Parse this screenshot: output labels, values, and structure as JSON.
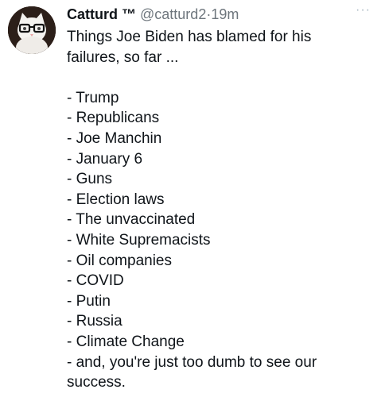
{
  "tweet": {
    "display_name": "Catturd ™",
    "handle": "@catturd2",
    "separator": "·",
    "time": "19m",
    "more_label": "···",
    "intro_line1": "Things Joe Biden has blamed for his",
    "intro_line2": "failures, so far ...",
    "items": [
      "- Trump",
      "- Republicans",
      "- Joe Manchin",
      "- January 6",
      "- Guns",
      "- Election laws",
      "- The unvaccinated",
      "- White Supremacists",
      "- Oil companies",
      "- COVID",
      "- Putin",
      "- Russia",
      "- Climate Change"
    ],
    "closing_line1": "- and, you're just too dumb to see our",
    "closing_line2": "success.",
    "avatar_icon": "cat-with-glasses-avatar-icon",
    "more_icon": "more-options-icon"
  },
  "colors": {
    "text": "#0f1419",
    "muted": "#6e767d",
    "more": "#aab8c2"
  }
}
